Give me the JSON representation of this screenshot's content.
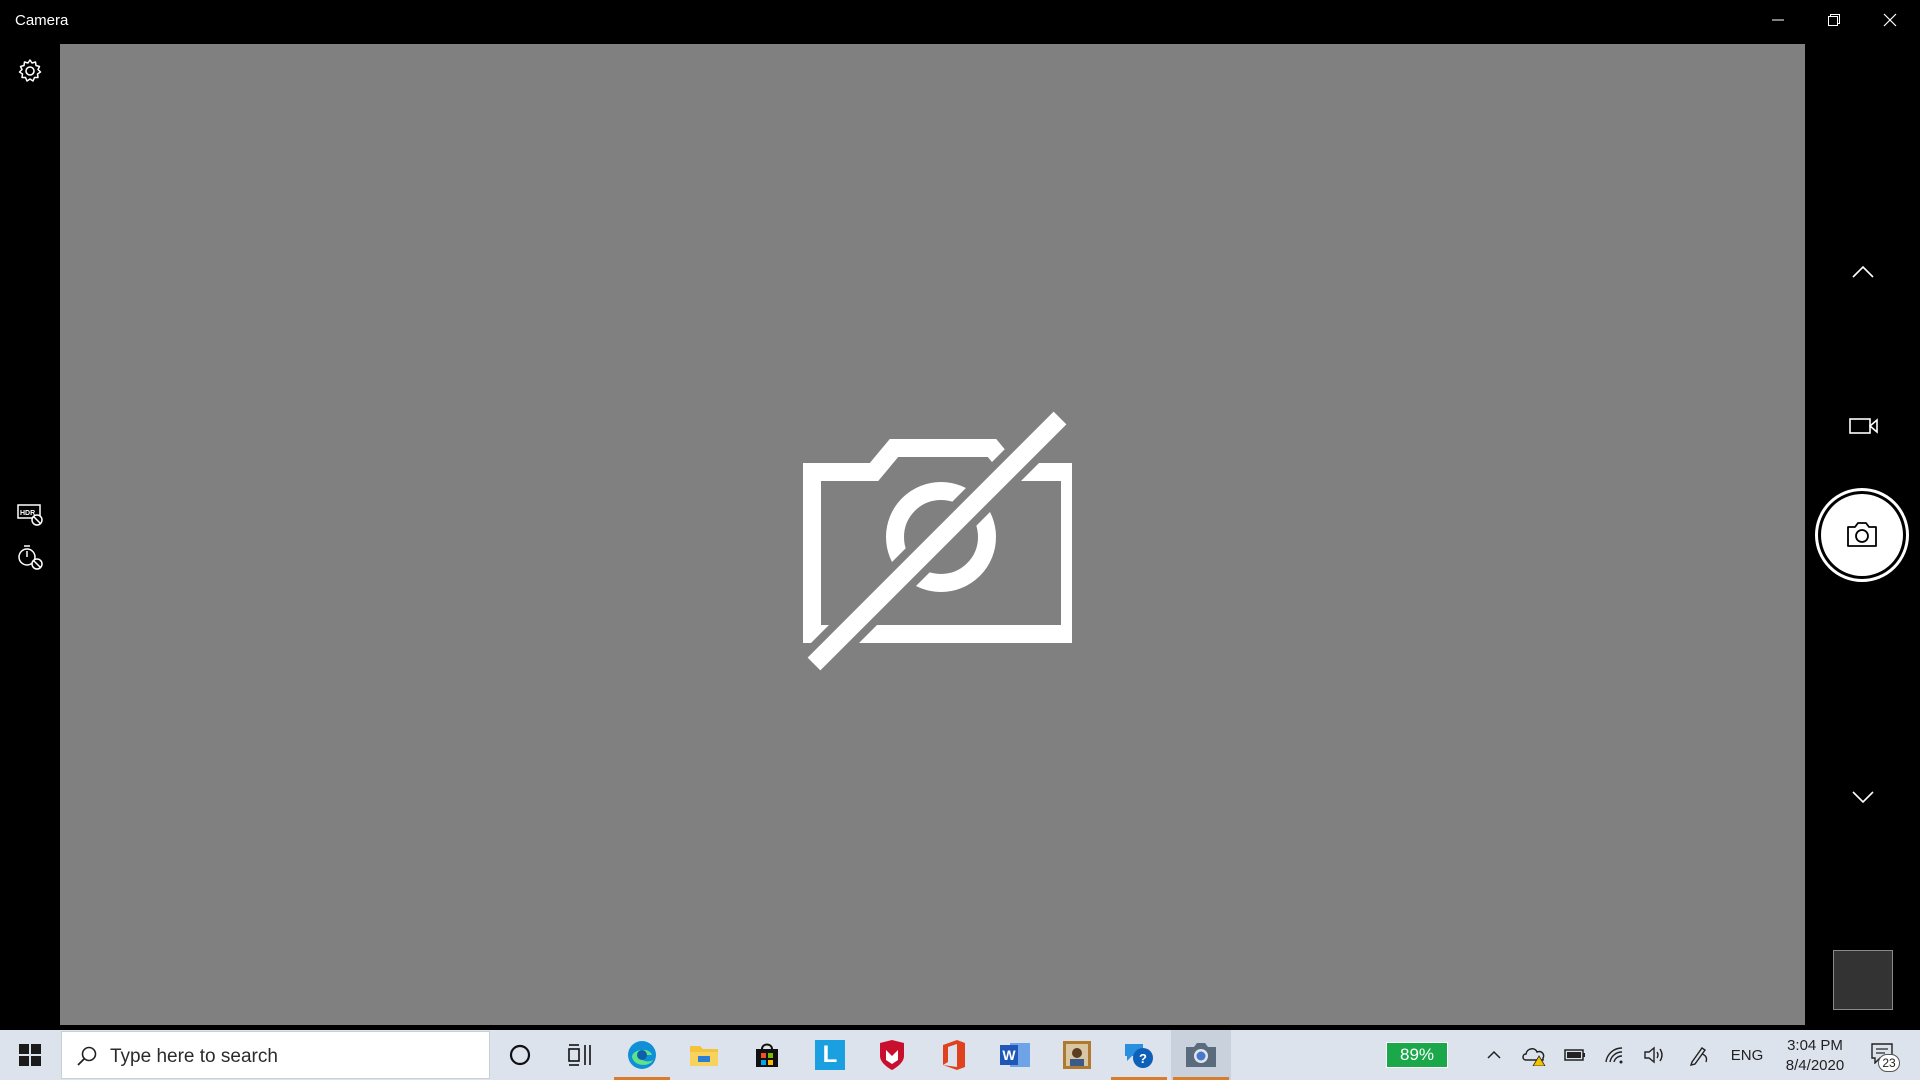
{
  "window": {
    "title": "Camera",
    "controls": [
      "minimize-icon",
      "restore-icon",
      "close-icon"
    ]
  },
  "left_rail": {
    "icons": [
      "gear-icon",
      "hdr-off-icon",
      "timer-off-icon"
    ]
  },
  "viewfinder": {
    "background": "#808080",
    "status_icon": "camera-off-icon"
  },
  "right_rail": {
    "icons": [
      "chevron-up-icon",
      "video-mode-icon",
      "photo-shutter-icon",
      "chevron-down-icon"
    ],
    "thumbnail": "last-capture-thumbnail"
  },
  "taskbar": {
    "search_placeholder": "Type here to search",
    "apps": [
      {
        "name": "cortana",
        "icon": "cortana-circle-icon"
      },
      {
        "name": "task-view",
        "icon": "task-view-icon"
      },
      {
        "name": "edge",
        "icon": "edge-icon",
        "open": true
      },
      {
        "name": "file-explorer",
        "icon": "folder-icon"
      },
      {
        "name": "store",
        "icon": "store-bag-icon"
      },
      {
        "name": "l-app",
        "icon": "l-app-icon",
        "label": "L"
      },
      {
        "name": "mcafee",
        "icon": "mcafee-shield-icon"
      },
      {
        "name": "office",
        "icon": "office-icon"
      },
      {
        "name": "word",
        "icon": "word-icon",
        "label": "W"
      },
      {
        "name": "photo-app",
        "icon": "photo-app-icon"
      },
      {
        "name": "get-help",
        "icon": "get-help-icon",
        "open": true
      },
      {
        "name": "camera",
        "icon": "camera-app-icon",
        "open": true,
        "active": true
      }
    ],
    "battery_percent": "89%",
    "tray_icons": [
      "chevron-up-icon",
      "onedrive-warning-icon",
      "battery-icon",
      "wifi-icon",
      "volume-icon",
      "pen-icon"
    ],
    "language": "ENG",
    "time": "3:04 PM",
    "date": "8/4/2020",
    "notification_count": "23",
    "accent_underline": "#d97c2b",
    "battery_color": "#1aa84b"
  }
}
